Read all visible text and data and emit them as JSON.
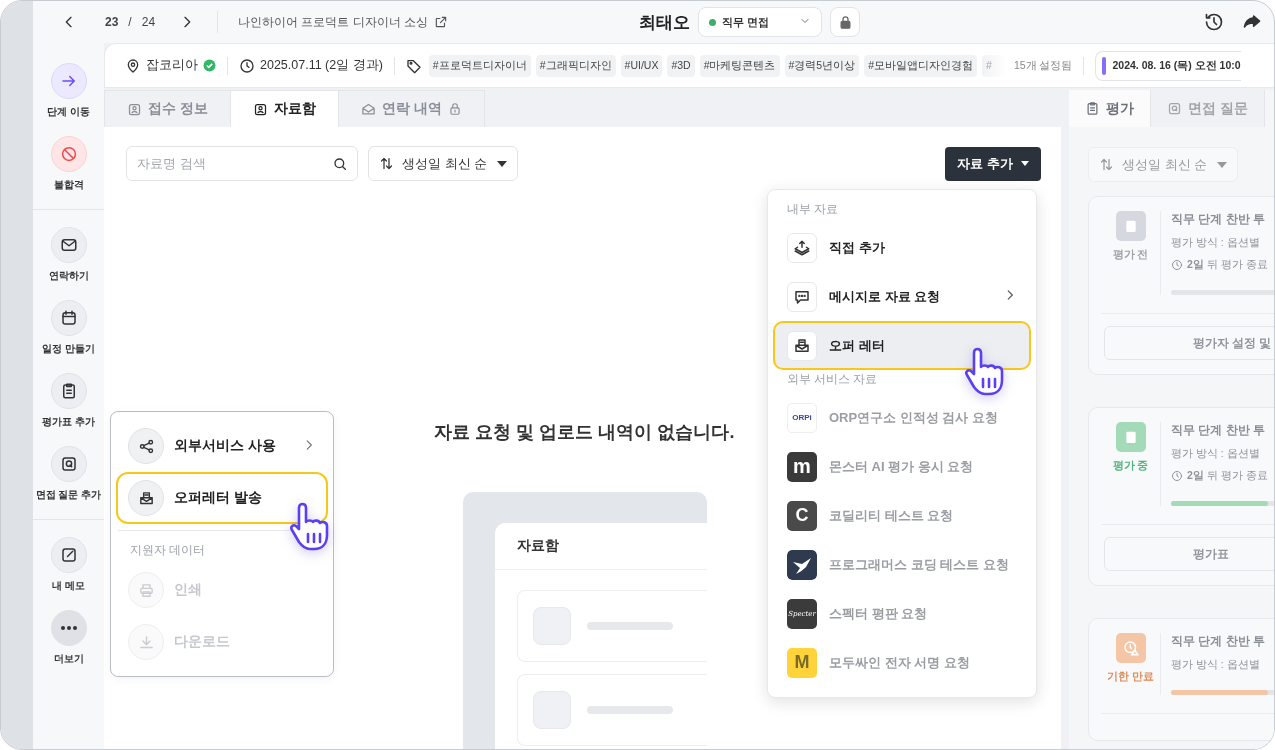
{
  "topbar": {
    "page_current": "23",
    "page_separator": "/",
    "page_total": "24",
    "project": "나인하이어 프로덕트 디자이너 소싱",
    "candidate": "최태오",
    "stage": {
      "label": "직무 면접",
      "color": "#3fae6a"
    }
  },
  "info": {
    "source": "잡코리아",
    "verified": true,
    "date": "2025.07.11 (2일 경과)",
    "tags": [
      "#프로덕트디자이너",
      "#그래픽디자인",
      "#UI/UX",
      "#3D",
      "#마케팅콘텐츠",
      "#경력5년이상",
      "#모바일앱디자인경험"
    ],
    "faded_tag": "#",
    "tag_count": "15개 설정됨",
    "schedule": "2024. 08. 16 (목) 오전 10:0"
  },
  "sidebar": {
    "groups": [
      {
        "items": [
          {
            "kind": "move",
            "label": "단계 이동"
          },
          {
            "kind": "reject",
            "label": "불합격"
          }
        ]
      },
      {
        "items": [
          {
            "kind": "contact",
            "label": "연락하기"
          },
          {
            "kind": "schedule",
            "label": "일정 만들기"
          },
          {
            "kind": "evaluation",
            "label": "평가표 추가"
          },
          {
            "kind": "question",
            "label": "면접 질문 추가"
          }
        ]
      },
      {
        "items": [
          {
            "kind": "memo",
            "label": "내 메모"
          },
          {
            "kind": "more",
            "label": "더보기"
          }
        ]
      }
    ]
  },
  "tabs": [
    {
      "label": "접수 정보",
      "selected": false,
      "locked": false
    },
    {
      "label": "자료함",
      "selected": true,
      "locked": false
    },
    {
      "label": "연락 내역",
      "selected": false,
      "locked": true
    }
  ],
  "search": {
    "placeholder": "자료명 검색"
  },
  "sort": {
    "label": "생성일 최신 순"
  },
  "add_button": "자료 추가",
  "empty_message": "자료 요청 및 업로드 내역이 없습니다.",
  "illustration": {
    "title": "자료함"
  },
  "eval_panel": {
    "tabs": [
      {
        "label": "평가",
        "selected": true
      },
      {
        "label": "면접 질문",
        "selected": false
      }
    ],
    "sort": "생성일 최신 순",
    "cards": [
      {
        "kind": "before",
        "status": "평가 전",
        "color": "#d5d8de",
        "title": "직무 단계 찬반 투",
        "method": "평가 방식 : 옵션별",
        "due": "**2일** 뒤 평가 종료",
        "level": 0,
        "button": "평가자 설정 및"
      },
      {
        "kind": "ongoing",
        "status": "평가 중",
        "color": "#a3dbb8",
        "title": "직무 단계 찬반 투",
        "method": "평가 방식 : 옵션별",
        "due": "**2일** 뒤 평가 종료",
        "level": 0.88,
        "button": "평가표"
      },
      {
        "kind": "expired",
        "status": "기한 만료",
        "color": "#f5c6a6",
        "title": "직무 단계 찬반 투",
        "method": "평가 방식 : 옵션별",
        "level": 0.88
      }
    ]
  },
  "action_menu": {
    "items": [
      {
        "kind": "share",
        "label": "외부서비스 사용",
        "submenu": true,
        "highlighted": false,
        "disabled": false
      },
      {
        "kind": "offer",
        "label": "오퍼레터 발송",
        "submenu": false,
        "highlighted": true,
        "disabled": false
      }
    ],
    "section": {
      "title": "지원자 데이터",
      "items": [
        {
          "kind": "print",
          "label": "인쇄",
          "submenu": false,
          "highlighted": false,
          "disabled": true
        },
        {
          "kind": "download",
          "label": "다운로드",
          "submenu": false,
          "highlighted": false,
          "disabled": true
        }
      ]
    }
  },
  "add_menu": {
    "sections": [
      {
        "title": "내부 자료",
        "items": [
          {
            "kind": "upload",
            "label": "직접 추가",
            "submenu": false,
            "highlighted": false,
            "disabled": false
          },
          {
            "kind": "message",
            "label": "메시지로 자료 요청",
            "submenu": true,
            "highlighted": false,
            "disabled": false
          },
          {
            "kind": "offer",
            "label": "오퍼 레터",
            "submenu": false,
            "highlighted": true,
            "disabled": false
          }
        ]
      },
      {
        "title": "외부 서비스 자료",
        "items": [
          {
            "kind": "orp",
            "label": "ORP연구소 인적성 검사 요청",
            "logo_text": "ORPi",
            "color": "#ffffff",
            "submenu": false,
            "highlighted": false,
            "disabled": true
          },
          {
            "kind": "monster",
            "label": "몬스터 AI 평가 응시 요청",
            "logo_text": "m",
            "color": "#3a3a3a",
            "submenu": false,
            "highlighted": false,
            "disabled": true
          },
          {
            "kind": "codility",
            "label": "코딜리티 테스트 요청",
            "logo_text": "C",
            "color": "#4a4a4a",
            "submenu": false,
            "highlighted": false,
            "disabled": true
          },
          {
            "kind": "programmers",
            "label": "프로그래머스 코딩 테스트 요청",
            "color": "#2e3a4e",
            "submenu": false,
            "highlighted": false,
            "disabled": true
          },
          {
            "kind": "spectter",
            "label": "스펙터 평판 요청",
            "logo_text": "Specter",
            "color": "#3b3b3b",
            "submenu": false,
            "highlighted": false,
            "disabled": true
          },
          {
            "kind": "modusign",
            "label": "모두싸인 전자 서명 요청",
            "logo_text": "M",
            "color": "#ffd43b",
            "submenu": false,
            "highlighted": false,
            "disabled": true
          }
        ]
      }
    ]
  }
}
